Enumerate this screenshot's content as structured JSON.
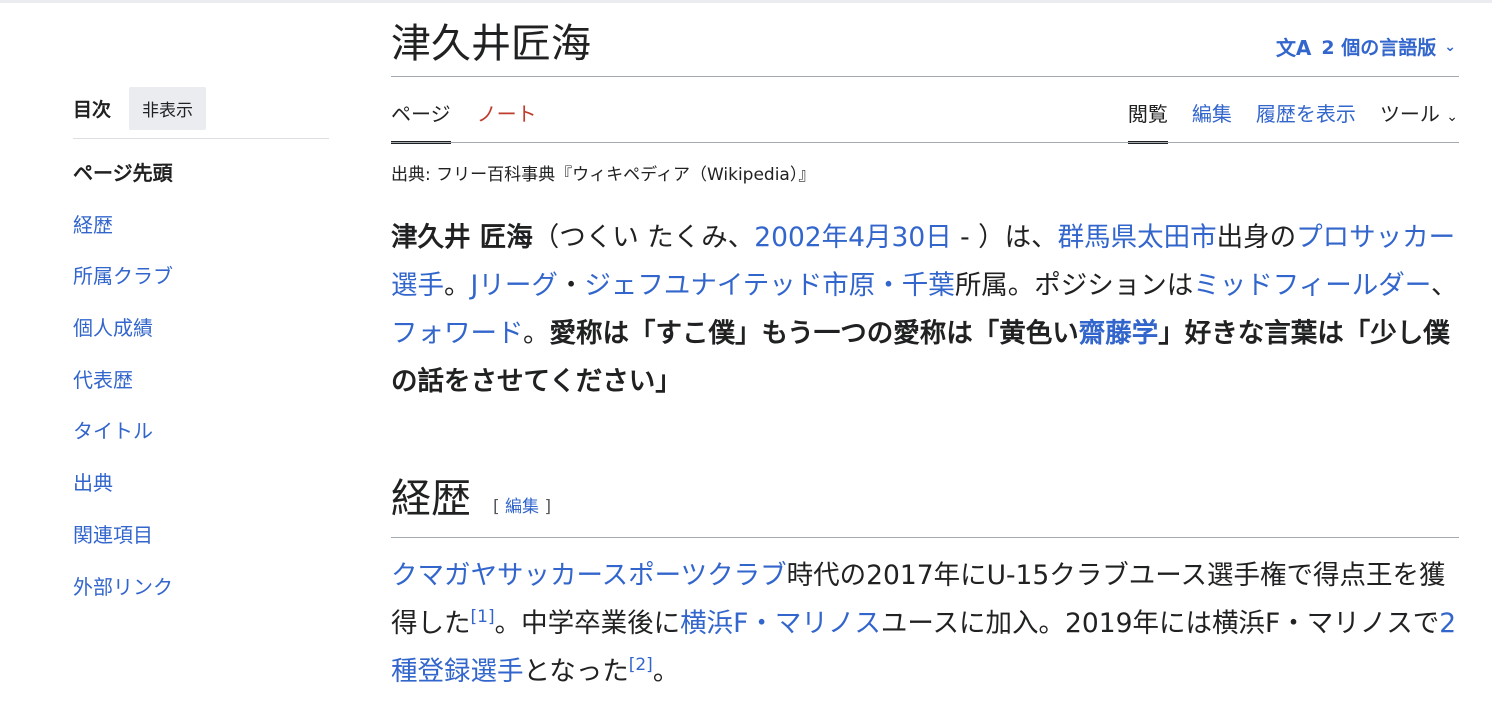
{
  "toc": {
    "title": "目次",
    "hide_label": "非表示",
    "items": [
      {
        "label": "ページ先頭",
        "current": true
      },
      {
        "label": "経歴"
      },
      {
        "label": "所属クラブ"
      },
      {
        "label": "個人成績"
      },
      {
        "label": "代表歴"
      },
      {
        "label": "タイトル"
      },
      {
        "label": "出典"
      },
      {
        "label": "関連項目"
      },
      {
        "label": "外部リンク"
      }
    ]
  },
  "header": {
    "title": "津久井匠海",
    "lang_label": "2 個の言語版",
    "lang_icon": "translate-icon",
    "chevron_icon": "chevron-down-icon"
  },
  "tabs": {
    "left": [
      {
        "label": "ページ"
      },
      {
        "label": "ノート"
      }
    ],
    "right": [
      {
        "label": "閲覧"
      },
      {
        "label": "編集"
      },
      {
        "label": "履歴を表示"
      },
      {
        "label": "ツール"
      }
    ]
  },
  "source_line": "出典: フリー百科事典『ウィキペディア（Wikipedia）』",
  "lead": {
    "name_bold": "津久井 匠海",
    "t1": "（つくい たくみ、",
    "birth_link": "2002年4月30日",
    "t2": " - ）は、",
    "place_link": "群馬県太田市",
    "t3": "出身の",
    "pro_link": "プロサッカー選手",
    "t4": "。",
    "league_link": "Jリーグ",
    "t5": "・",
    "club_link": "ジェフユナイテッド市原・千葉",
    "t6": "所属。ポジションは",
    "mf_link": "ミッドフィールダー",
    "t7": "、",
    "fw_link": "フォワード",
    "t8": "。",
    "b1": "愛称は「すこ僕」もう一つの愛称は「黄色い",
    "saito_link": "齋藤学",
    "b2": "」好きな言葉は「少し僕の話をさせてください」"
  },
  "section": {
    "heading": "経歴",
    "edit_open": "[ ",
    "edit_label": "編集",
    "edit_close": " ]"
  },
  "para": {
    "club_link": "クマガヤサッカースポーツクラブ",
    "t1": "時代の2017年にU-15クラブユース選手権で得点王を獲得した",
    "ref1": "[1]",
    "t2": "。中学卒業後に",
    "yokohama_link": "横浜F・マリノス",
    "t3": "ユースに加入。2019年には横浜F・マリノスで",
    "type2_link": "2種登録選手",
    "t4": "となった",
    "ref2": "[2]",
    "t5": "。"
  }
}
